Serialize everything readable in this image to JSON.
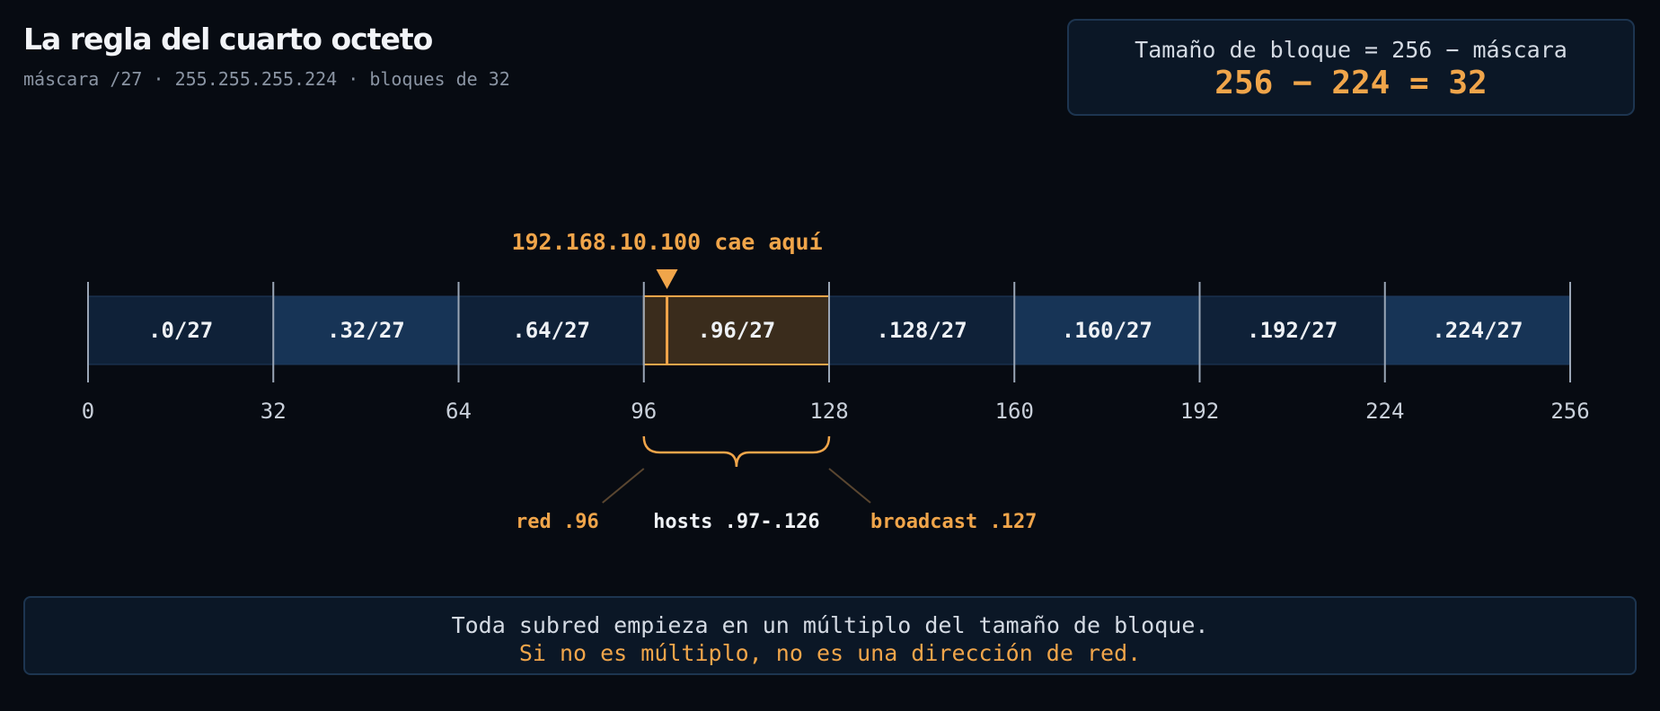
{
  "header": {
    "title": "La regla del cuarto octeto",
    "subtitle": "máscara /27 · 255.255.255.224 · bloques de 32"
  },
  "formula": {
    "label": "Tamaño de bloque = 256 − máscara",
    "value": "256 − 224 = 32"
  },
  "octet_line": {
    "block_size": 32,
    "range": [
      0,
      256
    ],
    "ticks": [
      "0",
      "32",
      "64",
      "96",
      "128",
      "160",
      "192",
      "224",
      "256"
    ],
    "blocks": [
      {
        "label": ".0/27",
        "start": 0
      },
      {
        "label": ".32/27",
        "start": 32
      },
      {
        "label": ".64/27",
        "start": 64
      },
      {
        "label": ".96/27",
        "start": 96
      },
      {
        "label": ".128/27",
        "start": 128
      },
      {
        "label": ".160/27",
        "start": 160
      },
      {
        "label": ".192/27",
        "start": 192
      },
      {
        "label": ".224/27",
        "start": 224
      }
    ],
    "highlight_block_start": 96,
    "marker_value": 100,
    "marker_label": "192.168.10.100 cae aquí"
  },
  "breakdown": {
    "network": "red .96",
    "hosts": "hosts .97-.126",
    "broadcast": "broadcast .127"
  },
  "footer": {
    "line1": "Toda subred empieza en un múltiplo del tamaño de bloque.",
    "line2": "Si no es múltiplo, no es una dirección de red."
  },
  "colors": {
    "accent": "#f0a54a",
    "block_dark": "#0f2138",
    "block_light": "#173456",
    "highlight_fill": "#3a2c1c"
  }
}
